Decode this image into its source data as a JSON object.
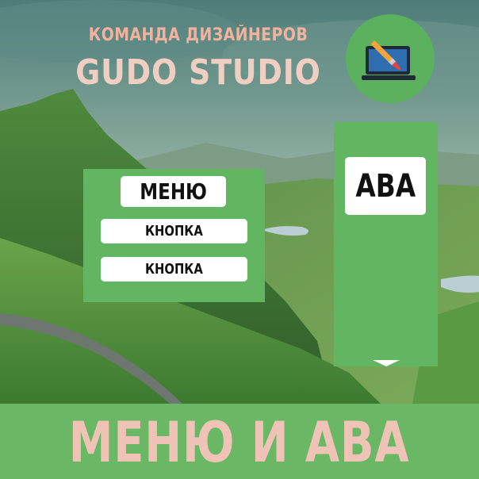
{
  "header": {
    "team_label": "КОМАНДА ДИЗАЙНЕРОВ",
    "studio_label": "GUDO STUDIO"
  },
  "logo": {
    "icon": "laptop-paintbrush-icon"
  },
  "menu_panel": {
    "title": "МЕНЮ",
    "buttons": [
      "КНОПКА",
      "КНОПКА"
    ]
  },
  "ava_panel": {
    "label": "АВА",
    "arrow_icon": "arrow-down-icon"
  },
  "footer": {
    "title": "МЕНЮ И АВА"
  },
  "colors": {
    "panel_green": "#62b662",
    "band_green": "#6ab765",
    "title_peach": "#f2b29d",
    "white": "#ffffff"
  }
}
